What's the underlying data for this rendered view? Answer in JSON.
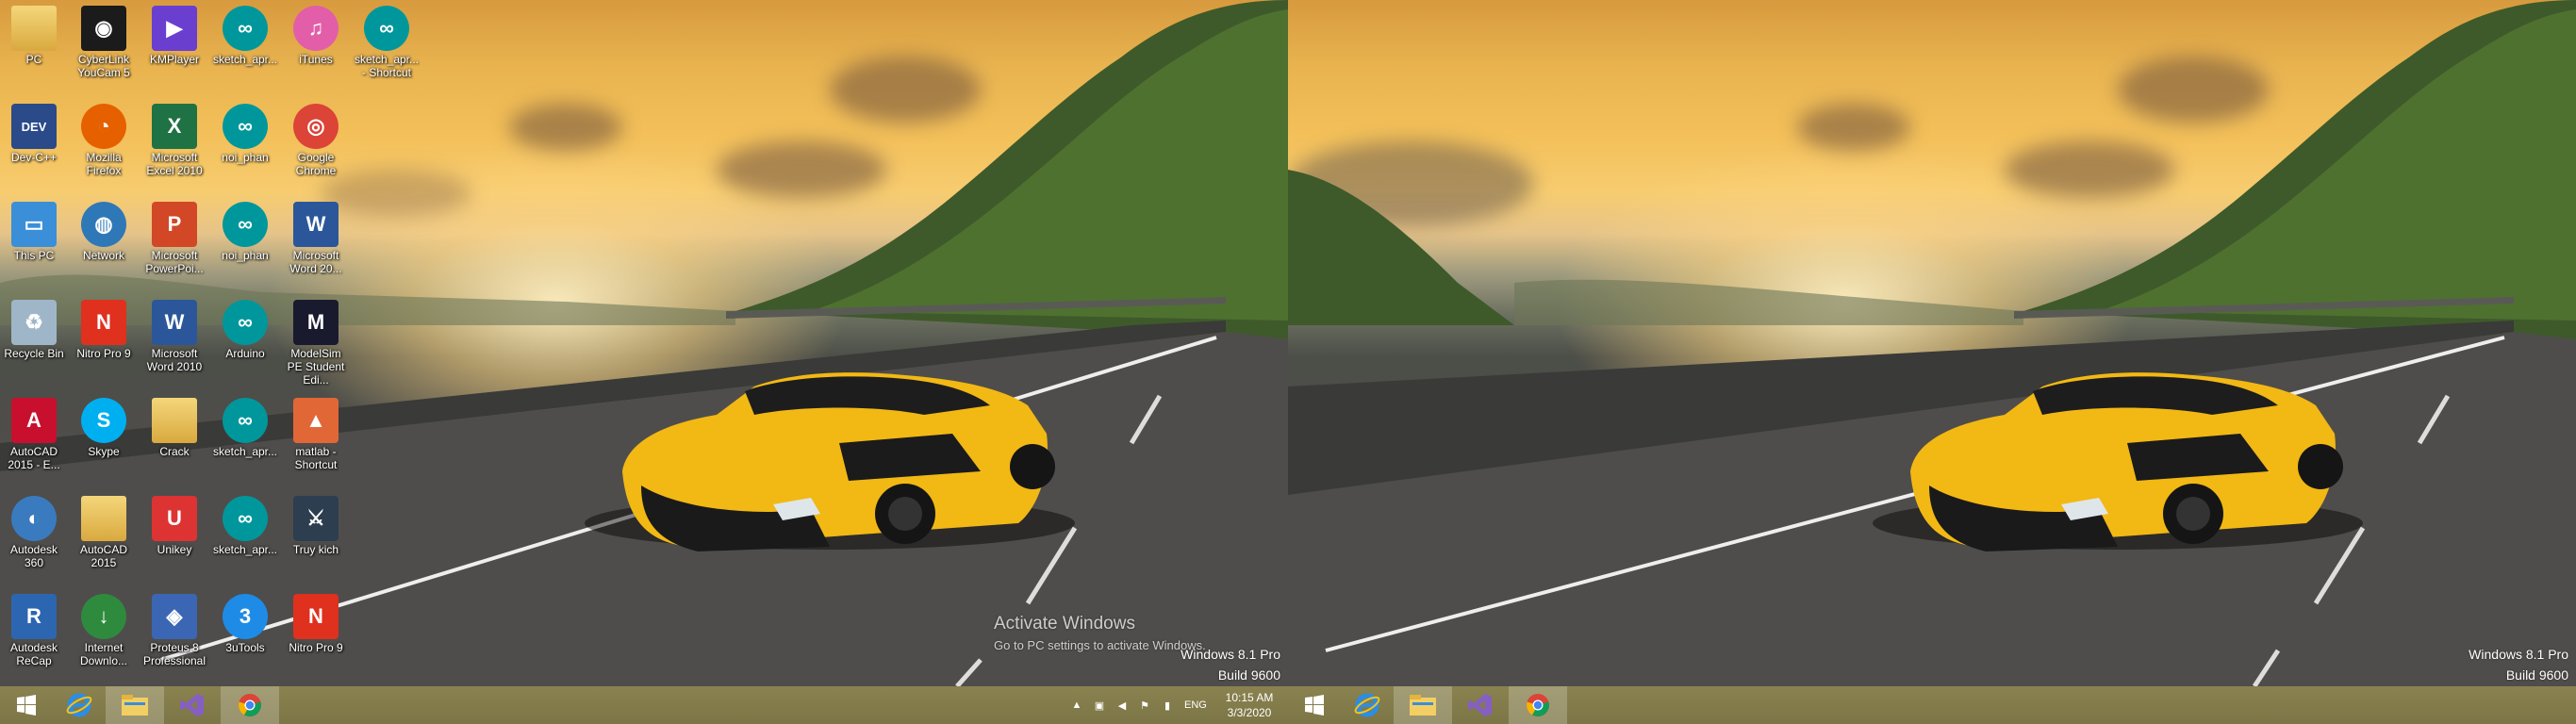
{
  "left_desktop": {
    "icons": [
      {
        "label": "PC",
        "icon": "folder-user-icon",
        "color": "#e8c35a"
      },
      {
        "label": "CyberLink YouCam 5",
        "icon": "webcam-icon",
        "color": "#1b1b1b"
      },
      {
        "label": "KMPlayer",
        "icon": "kmplayer-icon",
        "color": "#6a3fd0"
      },
      {
        "label": "sketch_apr...",
        "icon": "arduino-file-icon",
        "color": "#00979c"
      },
      {
        "label": "iTunes",
        "icon": "itunes-icon",
        "color": "#e35ea8"
      },
      {
        "label": "sketch_apr... - Shortcut",
        "icon": "arduino-file-icon",
        "color": "#00979c"
      },
      {
        "label": "Dev-C++",
        "icon": "devcpp-icon",
        "color": "#2a4a8a"
      },
      {
        "label": "Mozilla Firefox",
        "icon": "firefox-icon",
        "color": "#e66000"
      },
      {
        "label": "Microsoft Excel 2010",
        "icon": "excel-icon",
        "color": "#1f7244"
      },
      {
        "label": "noi_phan",
        "icon": "arduino-file-icon",
        "color": "#00979c"
      },
      {
        "label": "Google Chrome",
        "icon": "chrome-icon",
        "color": "#db4437"
      },
      {
        "label": "This PC",
        "icon": "computer-icon",
        "color": "#3a8fd8"
      },
      {
        "label": "Network",
        "icon": "network-icon",
        "color": "#2f78b8"
      },
      {
        "label": "Microsoft PowerPoi...",
        "icon": "powerpoint-icon",
        "color": "#d24726"
      },
      {
        "label": "noi_phan",
        "icon": "arduino-icon",
        "color": "#00979c"
      },
      {
        "label": "Microsoft Word 20...",
        "icon": "word-icon",
        "color": "#2b579a"
      },
      {
        "label": "Recycle Bin",
        "icon": "recycle-bin-icon",
        "color": "#9fb6c8"
      },
      {
        "label": "Nitro Pro 9",
        "icon": "nitro-icon",
        "color": "#e0301e"
      },
      {
        "label": "Microsoft Word 2010",
        "icon": "word-icon",
        "color": "#2b579a"
      },
      {
        "label": "Arduino",
        "icon": "arduino-icon",
        "color": "#00979c"
      },
      {
        "label": "ModelSim PE Student Edi...",
        "icon": "modelsim-icon",
        "color": "#1a1a2e"
      },
      {
        "label": "AutoCAD 2015 - E...",
        "icon": "autocad-icon",
        "color": "#c8102e"
      },
      {
        "label": "Skype",
        "icon": "skype-icon",
        "color": "#00aff0"
      },
      {
        "label": "Crack",
        "icon": "folder-icon",
        "color": "#e8c35a"
      },
      {
        "label": "sketch_apr...",
        "icon": "arduino-icon",
        "color": "#00979c"
      },
      {
        "label": "matlab - Shortcut",
        "icon": "matlab-icon",
        "color": "#e16737"
      },
      {
        "label": "Autodesk 360",
        "icon": "autodesk360-icon",
        "color": "#3a7bbf"
      },
      {
        "label": "AutoCAD 2015",
        "icon": "folder-autocad-icon",
        "color": "#e8c35a"
      },
      {
        "label": "Unikey",
        "icon": "unikey-icon",
        "color": "#d33"
      },
      {
        "label": "sketch_apr...",
        "icon": "arduino-file-icon",
        "color": "#00979c"
      },
      {
        "label": "Truy kich",
        "icon": "game-icon",
        "color": "#2c3e50"
      },
      {
        "label": "Autodesk ReCap",
        "icon": "recap-icon",
        "color": "#2c66b0"
      },
      {
        "label": "Internet Downlo...",
        "icon": "idm-icon",
        "color": "#2e8b3e"
      },
      {
        "label": "Proteus 8 Professional",
        "icon": "proteus-icon",
        "color": "#3a66b4"
      },
      {
        "label": "3uTools",
        "icon": "3utools-icon",
        "color": "#1e8ce6"
      },
      {
        "label": "Nitro Pro 9",
        "icon": "nitro-icon",
        "color": "#e0301e"
      }
    ],
    "activation": {
      "title": "Activate Windows",
      "subtitle": "Go to PC settings to activate Windows."
    },
    "watermark": {
      "edition": "Windows 8.1 Pro",
      "build": "Build 9600"
    }
  },
  "right_desktop": {
    "watermark": {
      "edition": "Windows 8.1 Pro",
      "build": "Build 9600"
    }
  },
  "taskbar_left": {
    "pinned": [
      "start-icon",
      "internet-explorer-icon",
      "file-explorer-icon",
      "visual-studio-icon",
      "chrome-icon"
    ],
    "tray": {
      "lang": "ENG",
      "time": "10:15 AM",
      "date": "3/3/2020"
    }
  },
  "taskbar_right": {
    "pinned": [
      "start-icon",
      "internet-explorer-icon",
      "file-explorer-icon",
      "visual-studio-icon",
      "chrome-icon"
    ]
  },
  "colors": {
    "taskbar": "#847c4a",
    "car": "#f2b814",
    "road": "#4f4d4b",
    "sky": "#f3c05a"
  }
}
